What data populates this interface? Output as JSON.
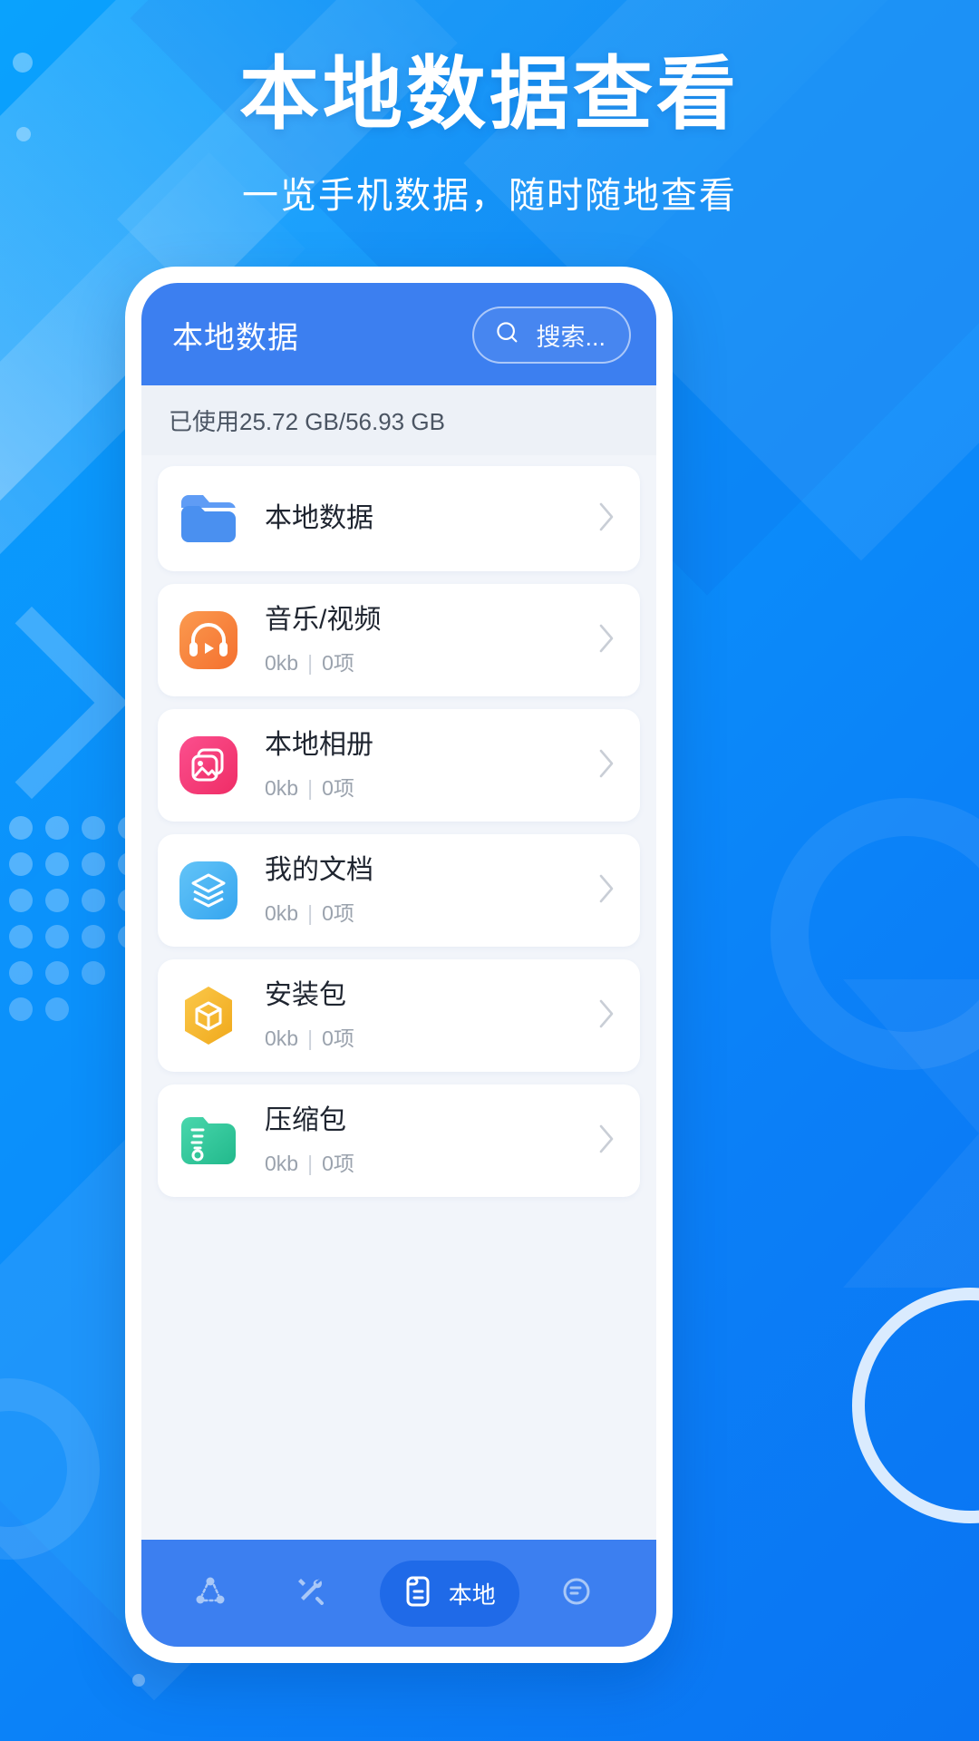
{
  "hero": {
    "title": "本地数据查看",
    "subtitle": "一览手机数据，随时随地查看"
  },
  "colors": {
    "page_bg": "#0b90fb",
    "app_header": "#3c7ff0",
    "nav_active": "#1f6ae8",
    "screen_bg": "#f2f5fa",
    "storage_bg": "#edf1f7"
  },
  "app": {
    "header": {
      "title": "本地数据",
      "search_placeholder": "搜索...",
      "search_icon": "search-icon"
    },
    "storage": {
      "text": "已使用25.72 GB/56.93 GB",
      "used": "25.72 GB",
      "total": "56.93 GB"
    },
    "list": [
      {
        "title": "本地数据",
        "sub": "",
        "size": "",
        "count": "",
        "icon": "folder-icon",
        "icon_color": "#4a90f0",
        "has_sub": false
      },
      {
        "title": "音乐/视频",
        "size": "0kb",
        "count": "0项",
        "icon": "headphones-icon",
        "icon_color": "#f7863c",
        "has_sub": true
      },
      {
        "title": "本地相册",
        "size": "0kb",
        "count": "0项",
        "icon": "photo-icon",
        "icon_color": "#f0336e",
        "has_sub": true
      },
      {
        "title": "我的文档",
        "size": "0kb",
        "count": "0项",
        "icon": "layers-icon",
        "icon_color": "#47b1f5",
        "has_sub": true
      },
      {
        "title": "安装包",
        "size": "0kb",
        "count": "0项",
        "icon": "package-box-icon",
        "icon_color": "#f5b82e",
        "has_sub": true
      },
      {
        "title": "压缩包",
        "size": "0kb",
        "count": "0项",
        "icon": "zip-folder-icon",
        "icon_color": "#2ecc9b",
        "has_sub": true
      }
    ],
    "separator": "|",
    "nav": [
      {
        "label": "",
        "icon": "share-nodes-icon",
        "active": false
      },
      {
        "label": "",
        "icon": "tools-icon",
        "active": false
      },
      {
        "label": "本地",
        "icon": "document-icon",
        "active": true
      },
      {
        "label": "",
        "icon": "profile-circle-icon",
        "active": false
      }
    ]
  }
}
